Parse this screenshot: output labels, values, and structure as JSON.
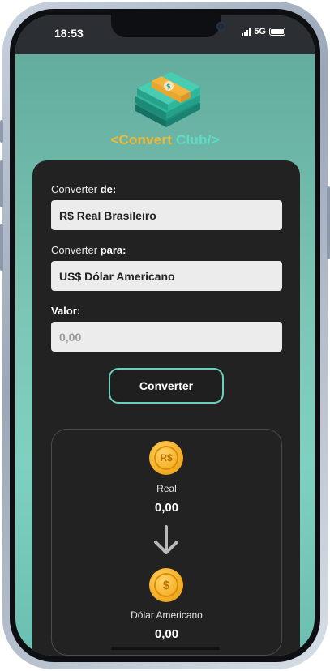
{
  "status": {
    "time": "18:53",
    "network": "5G"
  },
  "brand": {
    "part1": "<Convert",
    "part2": "Club/>"
  },
  "form": {
    "from_label": "Converter",
    "from_label_bold": "de:",
    "from_value": "R$ Real Brasileiro",
    "to_label": "Converter",
    "to_label_bold": "para:",
    "to_value": "US$ Dólar Americano",
    "amount_label": "Valor:",
    "amount_placeholder": "0,00",
    "convert_button": "Converter"
  },
  "result": {
    "from_symbol": "R$",
    "from_name": "Real",
    "from_value": "0,00",
    "to_symbol": "$",
    "to_name": "Dólar Americano",
    "to_value": "0,00"
  },
  "colors": {
    "accent": "#69d0bd",
    "coin": "#f5b22a",
    "brand_orange": "#f5b82e",
    "brand_teal": "#5fdcc6"
  }
}
